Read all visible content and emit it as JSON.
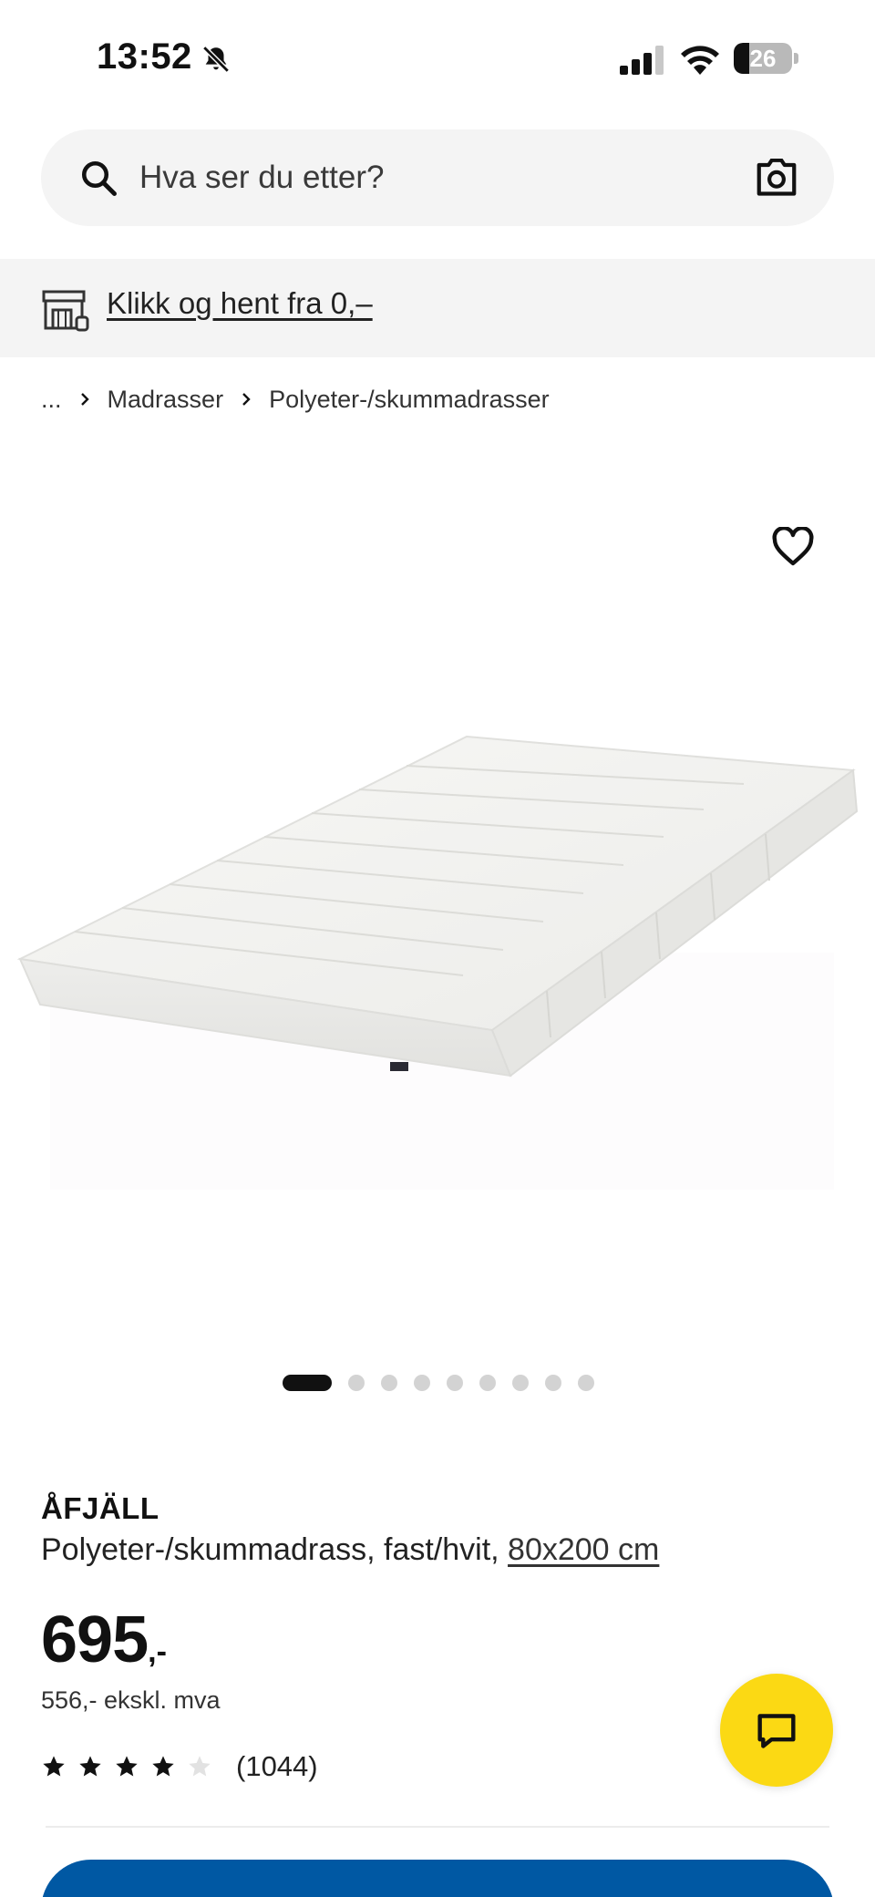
{
  "status_bar": {
    "time": "13:52",
    "battery": "26",
    "battery_level": 0.26
  },
  "search": {
    "placeholder": "Hva ser du etter?"
  },
  "banner": {
    "collect_label": "Klikk og hent fra 0,–"
  },
  "breadcrumb": {
    "ellipsis": "...",
    "items": [
      "Madrasser",
      "Polyeter-/skummadrasser"
    ]
  },
  "gallery": {
    "image_count": 9,
    "active_index": 0
  },
  "product": {
    "name": "ÅFJÄLL",
    "description": "Polyeter-/skummadrass, fast/hvit, ",
    "size_link": "80x200 cm",
    "price_main": "695",
    "price_suffix": ",-",
    "price_ex_vat": "556,- ekskl. mva",
    "rating": 4,
    "rating_max": 5,
    "review_count": "(1044)"
  },
  "colors": {
    "accent_blue": "#0058a3",
    "chat_yellow": "#fbd914",
    "search_bg": "#f4f4f4"
  },
  "icons": {
    "bell": "bell-slash-icon",
    "search": "search-icon",
    "camera": "camera-icon",
    "store": "store-icon",
    "favorite": "heart-icon",
    "chat": "chat-icon"
  }
}
